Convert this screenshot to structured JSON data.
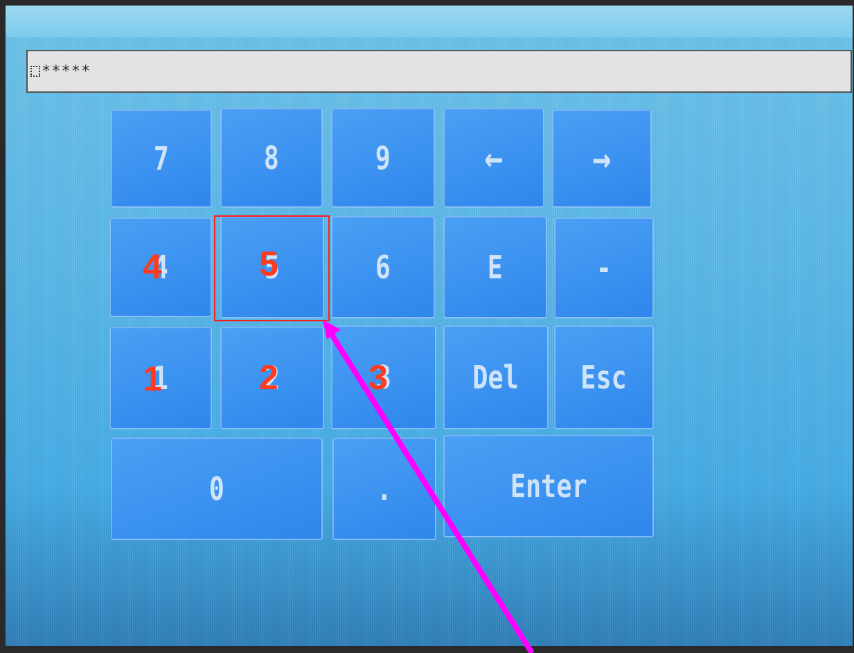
{
  "input": {
    "value": "*****"
  },
  "keys": {
    "k7": "7",
    "k8": "8",
    "k9": "9",
    "left": "←",
    "right": "→",
    "k4": "4",
    "k5": "5",
    "k6": "6",
    "e": "E",
    "minus": "-",
    "k1": "1",
    "k2": "2",
    "k3": "3",
    "del": "Del",
    "esc": "Esc",
    "k0": "0",
    "dot": ".",
    "enter": "Enter"
  },
  "annotations": {
    "n4": "4",
    "n5": "5",
    "n1": "1",
    "n2": "2",
    "n3": "3"
  },
  "colors": {
    "annotation": "#ff3b1f",
    "arrow": "#ff00ff",
    "highlight": "#ff1a1a"
  },
  "icons": {
    "cursor": "cursor-icon",
    "left": "arrow-left-icon",
    "right": "arrow-right-icon"
  }
}
